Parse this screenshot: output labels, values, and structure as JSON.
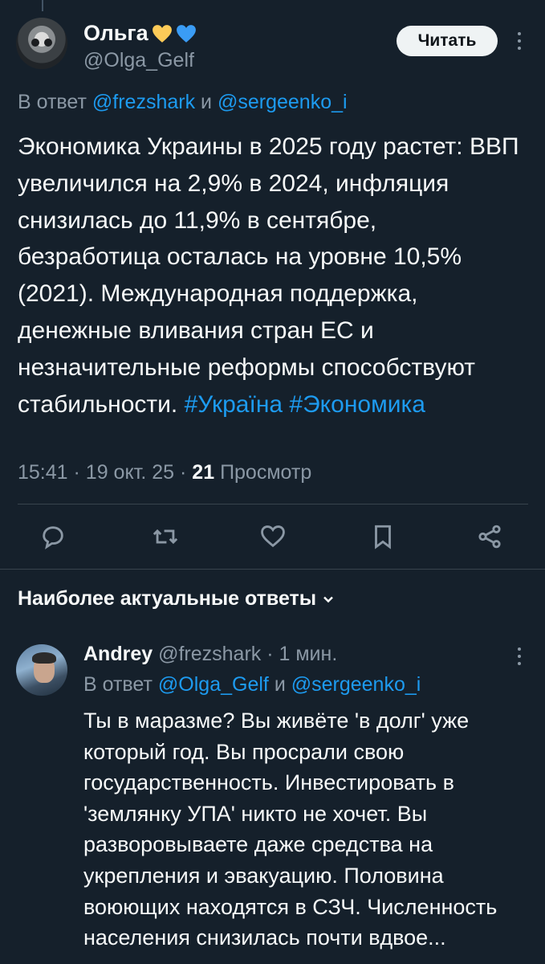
{
  "tweet": {
    "author_name": "Ольга",
    "author_emoji": [
      "yellow-heart",
      "blue-heart"
    ],
    "author_handle": "@Olga_Gelf",
    "follow_label": "Читать",
    "reply_to_prefix": "В ответ",
    "reply_to_user1": "@frezshark",
    "reply_to_and": "и",
    "reply_to_user2": "@sergeenko_i",
    "text": "Экономика Украины в 2025 году растет: ВВП увеличился на 2,9% в 2024, инфляция снизилась до 11,9% в сентябре, безработица осталась на уровне 10,5% (2021). Международная поддержка, денежные вливания стран ЕС и незначительные реформы способствуют стабильности.",
    "hashtag1": "#Україна",
    "hashtag2": "#Экономика",
    "time": "15:41",
    "date": "19 окт. 25",
    "views_count": "21",
    "views_label": "Просмотр",
    "actions": [
      "reply-icon",
      "retweet-icon",
      "like-icon",
      "bookmark-icon",
      "share-icon"
    ]
  },
  "replies_section": {
    "title": "Наиболее актуальные ответы"
  },
  "reply": {
    "author_name": "Andrey",
    "author_handle": "@frezshark",
    "time_ago": "1 мин.",
    "reply_to_prefix": "В ответ",
    "reply_to_user1": "@Olga_Gelf",
    "reply_to_and": "и",
    "reply_to_user2": "@sergeenko_i",
    "text": "Ты в маразме? Вы живёте 'в долг' уже который год. Вы просрали свою государственность. Инвестировать в 'землянку УПА' никто не хочет. Вы разворовываете даже средства на укрепления и эвакуацию. Половина воюющих находятся в СЗЧ. Численность населения снизилась почти вдвое..."
  },
  "colors": {
    "background": "#15202b",
    "text": "#f7f9f9",
    "secondary": "#8b98a5",
    "accent": "#1d9bf0",
    "divider": "#38444d"
  }
}
